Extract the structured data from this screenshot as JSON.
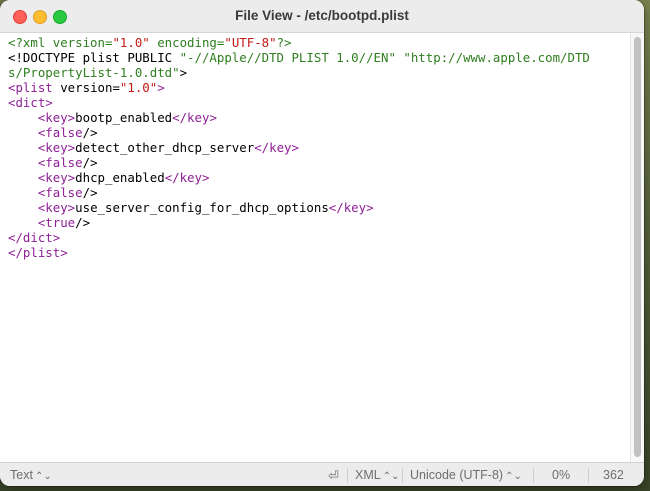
{
  "window": {
    "title": "File View - /etc/bootpd.plist"
  },
  "editor": {
    "lines": [
      [
        {
          "t": "<?xml version=",
          "c": "decl"
        },
        {
          "t": "\"1.0\"",
          "c": "str"
        },
        {
          "t": " encoding=",
          "c": "decl"
        },
        {
          "t": "\"UTF-8\"",
          "c": "str"
        },
        {
          "t": "?>",
          "c": "decl"
        }
      ],
      [
        {
          "t": "<!DOCTYPE plist PUBLIC ",
          "c": "text"
        },
        {
          "t": "\"-//Apple//DTD PLIST 1.0//EN\"",
          "c": "decl"
        },
        {
          "t": " ",
          "c": "text"
        },
        {
          "t": "\"http://www.apple.com/DTD",
          "c": "decl"
        }
      ],
      [
        {
          "t": "s/PropertyList-1.0.dtd\"",
          "c": "decl"
        },
        {
          "t": ">",
          "c": "text"
        }
      ],
      [
        {
          "t": "<plist",
          "c": "tag"
        },
        {
          "t": " version=",
          "c": "text"
        },
        {
          "t": "\"1.0\"",
          "c": "str"
        },
        {
          "t": ">",
          "c": "tag"
        }
      ],
      [
        {
          "t": "<dict>",
          "c": "tag"
        }
      ],
      [
        {
          "t": "    ",
          "c": "text"
        },
        {
          "t": "<key>",
          "c": "tag"
        },
        {
          "t": "bootp_enabled",
          "c": "text"
        },
        {
          "t": "</key>",
          "c": "tag"
        }
      ],
      [
        {
          "t": "    ",
          "c": "text"
        },
        {
          "t": "<false",
          "c": "tag"
        },
        {
          "t": "/>",
          "c": "text"
        }
      ],
      [
        {
          "t": "    ",
          "c": "text"
        },
        {
          "t": "<key>",
          "c": "tag"
        },
        {
          "t": "detect_other_dhcp_server",
          "c": "text"
        },
        {
          "t": "</key>",
          "c": "tag"
        }
      ],
      [
        {
          "t": "    ",
          "c": "text"
        },
        {
          "t": "<false",
          "c": "tag"
        },
        {
          "t": "/>",
          "c": "text"
        }
      ],
      [
        {
          "t": "    ",
          "c": "text"
        },
        {
          "t": "<key>",
          "c": "tag"
        },
        {
          "t": "dhcp_enabled",
          "c": "text"
        },
        {
          "t": "</key>",
          "c": "tag"
        }
      ],
      [
        {
          "t": "    ",
          "c": "text"
        },
        {
          "t": "<false",
          "c": "tag"
        },
        {
          "t": "/>",
          "c": "text"
        }
      ],
      [
        {
          "t": "    ",
          "c": "text"
        },
        {
          "t": "<key>",
          "c": "tag"
        },
        {
          "t": "use_server_config_for_dhcp_options",
          "c": "text"
        },
        {
          "t": "</key>",
          "c": "tag"
        }
      ],
      [
        {
          "t": "    ",
          "c": "text"
        },
        {
          "t": "<true",
          "c": "tag"
        },
        {
          "t": "/>",
          "c": "text"
        }
      ],
      [
        {
          "t": "</dict>",
          "c": "tag"
        }
      ],
      [
        {
          "t": "</plist>",
          "c": "tag"
        }
      ]
    ]
  },
  "statusbar": {
    "mode": "Text",
    "line_ending_icon": "return-arrow-icon",
    "line_ending_glyph": "⏎",
    "syntax": "XML",
    "encoding": "Unicode (UTF-8)",
    "scroll_percent": "0%",
    "char_count": "362",
    "chevron": "⌃⌄"
  },
  "colors": {
    "declaration": "#2f7e1f",
    "string": "#c41a16",
    "tag": "#8f1f96",
    "text": "#000000"
  }
}
